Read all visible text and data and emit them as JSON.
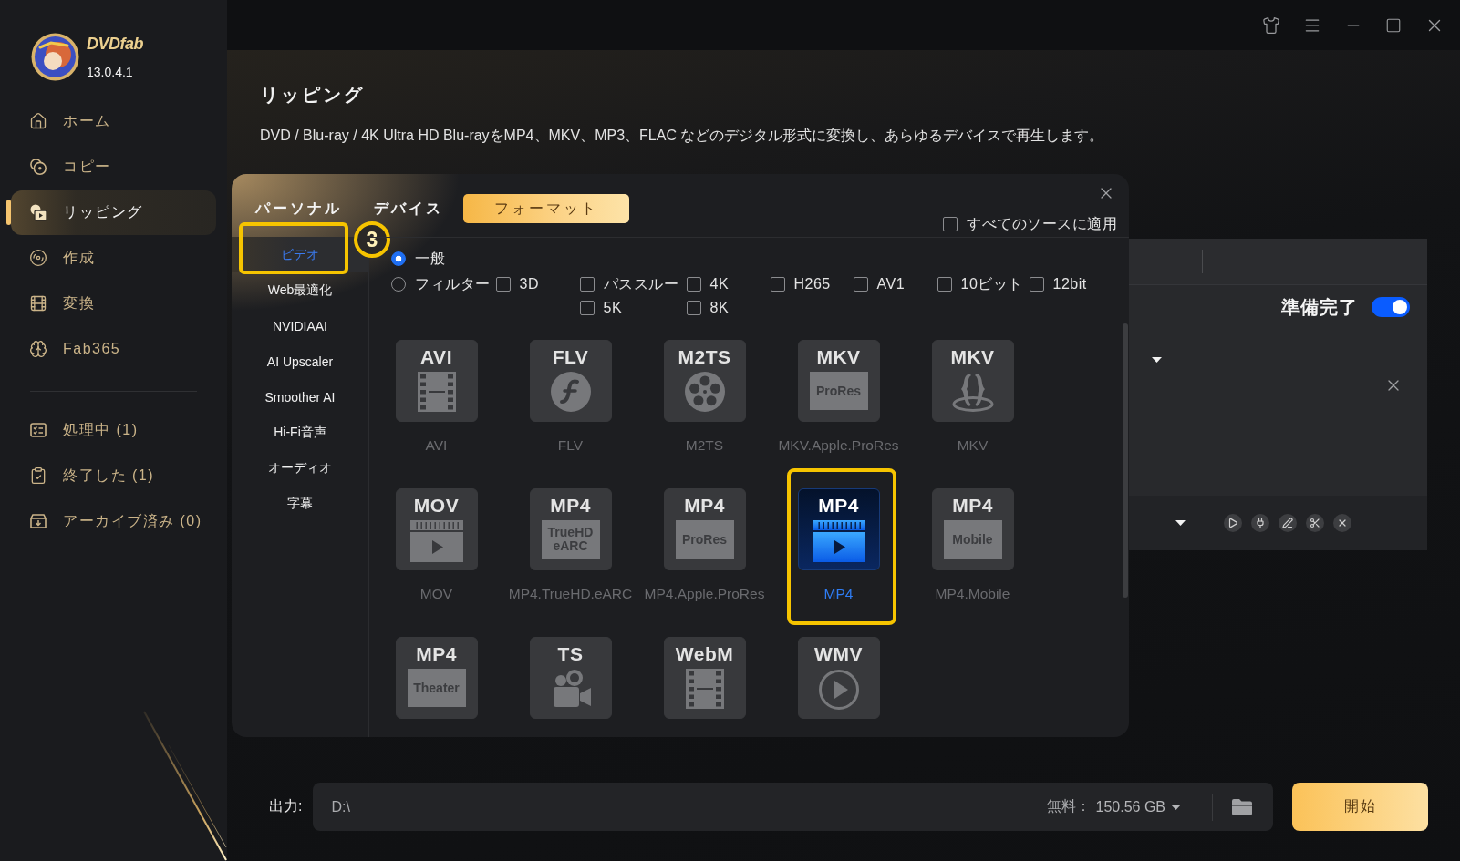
{
  "app": {
    "logo_text": "DVDfab",
    "version": "13.0.4.1"
  },
  "sidebar": {
    "nav_items": [
      {
        "kind": "home",
        "label": "ホーム",
        "selected": false
      },
      {
        "kind": "copy",
        "label": "コピー",
        "selected": false
      },
      {
        "kind": "ripping",
        "label": "リッピング",
        "selected": true
      },
      {
        "kind": "create",
        "label": "作成",
        "selected": false
      },
      {
        "kind": "convert",
        "label": "変換",
        "selected": false
      },
      {
        "kind": "fab365",
        "label": "Fab365",
        "selected": false
      }
    ],
    "task_items": [
      {
        "kind": "processing",
        "label": "処理中 (1)",
        "selected": false
      },
      {
        "kind": "finished",
        "label": "終了した (1)",
        "selected": false
      },
      {
        "kind": "archived",
        "label": "アーカイブ済み (0)",
        "selected": false
      }
    ]
  },
  "page": {
    "title": "リッピング",
    "description": "DVD / Blu-ray / 4K Ultra HD Blu-rayをMP4、MKV、MP3、FLAC などのデジタル形式に変換し、あらゆるデバイスで再生します。"
  },
  "profile_dialog": {
    "tabs": [
      {
        "label": "パーソナル",
        "selected": false
      },
      {
        "label": "デバイス",
        "selected": false
      },
      {
        "label": "フォーマット",
        "selected": true
      }
    ],
    "apply_to_all": {
      "label": "すべてのソースに適用",
      "checked": false
    },
    "categories": [
      {
        "label": "ビデオ",
        "selected": true,
        "highlighted": true,
        "callout": "3"
      },
      {
        "label": "Web最適化",
        "selected": false,
        "highlighted": false
      },
      {
        "label": "NVIDIAAI",
        "selected": false,
        "highlighted": false
      },
      {
        "label": "AI Upscaler",
        "selected": false,
        "highlighted": false
      },
      {
        "label": "Smoother AI",
        "selected": false,
        "highlighted": false
      },
      {
        "label": "Hi-Fi音声",
        "selected": false,
        "highlighted": false
      },
      {
        "label": "オーディオ",
        "selected": false,
        "highlighted": false
      },
      {
        "label": "字幕",
        "selected": false,
        "highlighted": false
      }
    ],
    "modes": [
      {
        "label": "一般",
        "selected": true
      },
      {
        "label": "フィルター",
        "selected": false
      }
    ],
    "filters": [
      {
        "label": "3D",
        "checked": false
      },
      {
        "label": "パススルー",
        "checked": false
      },
      {
        "label": "4K",
        "checked": false
      },
      {
        "label": "H265",
        "checked": false
      },
      {
        "label": "AV1",
        "checked": false
      },
      {
        "label": "10ビット",
        "checked": false
      },
      {
        "label": "12bit",
        "checked": false
      },
      {
        "label": "5K",
        "checked": false
      },
      {
        "label": "8K",
        "checked": false
      }
    ],
    "format_tiles": [
      {
        "kind": "film",
        "title": "AVI",
        "label": "AVI",
        "selected": false,
        "highlighted": false
      },
      {
        "kind": "swoosh",
        "title": "FLV",
        "label": "FLV",
        "selected": false,
        "highlighted": false
      },
      {
        "kind": "reel",
        "title": "M2TS",
        "label": "M2TS",
        "selected": false,
        "highlighted": false
      },
      {
        "kind": "plate",
        "title": "MKV",
        "plate": "ProRes",
        "label": "MKV.Apple.ProRes",
        "selected": false,
        "highlighted": false
      },
      {
        "kind": "braces",
        "title": "MKV",
        "label": "MKV",
        "selected": false,
        "highlighted": false
      },
      {
        "kind": "video",
        "title": "MOV",
        "label": "MOV",
        "selected": false,
        "highlighted": false
      },
      {
        "kind": "plate",
        "title": "MP4",
        "plate": "TrueHD eARC",
        "label": "MP4.TrueHD.eARC",
        "selected": false,
        "highlighted": false
      },
      {
        "kind": "plate",
        "title": "MP4",
        "plate": "ProRes",
        "label": "MP4.Apple.ProRes",
        "selected": false,
        "highlighted": false
      },
      {
        "kind": "video",
        "title": "MP4",
        "label": "MP4",
        "selected": true,
        "highlighted": true
      },
      {
        "kind": "plate",
        "title": "MP4",
        "plate": "Mobile",
        "label": "MP4.Mobile",
        "selected": false,
        "highlighted": false
      },
      {
        "kind": "plate",
        "title": "MP4",
        "plate": "Theater",
        "selected": false,
        "highlighted": false
      },
      {
        "kind": "camera",
        "title": "TS",
        "selected": false,
        "highlighted": false
      },
      {
        "kind": "film",
        "title": "WebM",
        "selected": false,
        "highlighted": false
      },
      {
        "kind": "play",
        "title": "WMV",
        "selected": false,
        "highlighted": false
      }
    ]
  },
  "task_card": {
    "ready_toggle": {
      "label": "準備完了",
      "on": true
    }
  },
  "output": {
    "label": "出力:",
    "path": "D:\\",
    "free_label": "無料：",
    "free_space": "150.56 GB"
  },
  "start_button": {
    "label": "開始"
  }
}
